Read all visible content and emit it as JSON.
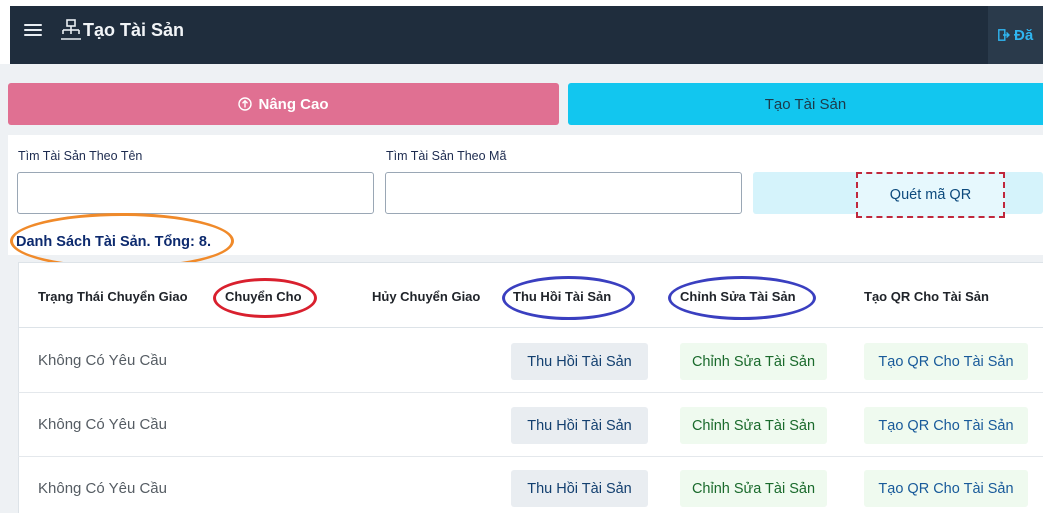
{
  "header": {
    "title": "Tạo Tài Sản",
    "logout_label": "Đă"
  },
  "actions": {
    "advanced_label": "Nâng Cao",
    "create_label": "Tạo Tài Sản"
  },
  "search": {
    "by_name_label": "Tìm Tài Sản Theo Tên",
    "by_code_label": "Tìm Tài Sản Theo Mã",
    "by_name_value": "",
    "by_code_value": "",
    "scan_qr_label": "Quét mã QR"
  },
  "list": {
    "title": "Danh Sách Tài Sản. Tổng: 8."
  },
  "table": {
    "columns": [
      "Trạng Thái Chuyển Giao",
      "Chuyển Cho",
      "Hủy Chuyển Giao",
      "Thu Hồi Tài Sản",
      "Chỉnh Sửa Tài Sản",
      "Tạo QR Cho Tài Sản"
    ],
    "rows": [
      {
        "status": "Không Có Yêu Cầu",
        "recall": "Thu Hồi Tài Sản",
        "edit": "Chỉnh Sửa Tài Sản",
        "qr": "Tạo QR Cho Tài Sản"
      },
      {
        "status": "Không Có Yêu Cầu",
        "recall": "Thu Hồi Tài Sản",
        "edit": "Chỉnh Sửa Tài Sản",
        "qr": "Tạo QR Cho Tài Sản"
      },
      {
        "status": "Không Có Yêu Cầu",
        "recall": "Thu Hồi Tài Sản",
        "edit": "Chỉnh Sửa Tài Sản",
        "qr": "Tạo QR Cho Tài Sản"
      }
    ]
  },
  "icons": {
    "menu": "hamburger-menu-icon",
    "asset": "asset-hierarchy-icon",
    "logout": "logout-icon",
    "advanced": "arrow-up-circle-icon"
  },
  "colors": {
    "topbar": "#1f2d3d",
    "advanced_button": "#e07092",
    "create_button": "#12c6ef",
    "annotation_orange": "#f08a2a",
    "annotation_red": "#d9202e",
    "annotation_blue": "#3a3fc0"
  }
}
